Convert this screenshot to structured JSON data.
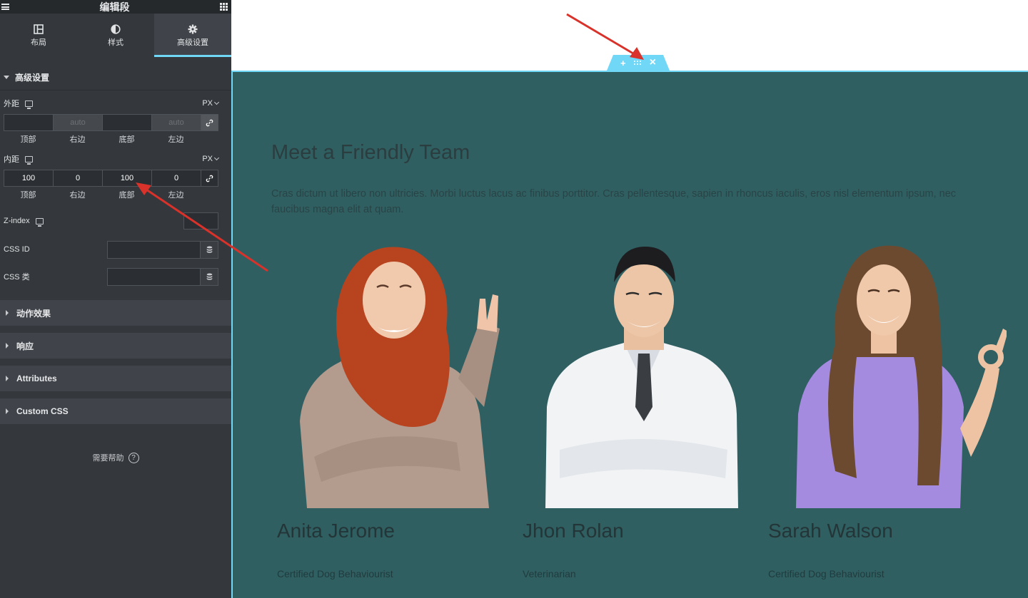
{
  "sidebar": {
    "title": "编辑段",
    "tabs": [
      {
        "label": "布局",
        "icon": "layout-icon"
      },
      {
        "label": "样式",
        "icon": "contrast-icon"
      },
      {
        "label": "高级设置",
        "icon": "gear-icon"
      }
    ],
    "active_tab": "高级设置",
    "advanced_section": {
      "title": "高级设置",
      "margin": {
        "label": "外距",
        "unit": "PX",
        "values": {
          "top": "",
          "right": "auto",
          "bottom": "",
          "left": "auto"
        },
        "sub_labels": [
          "顶部",
          "右边",
          "底部",
          "左边"
        ]
      },
      "padding": {
        "label": "内距",
        "unit": "PX",
        "values": {
          "top": "100",
          "right": "0",
          "bottom": "100",
          "left": "0"
        },
        "sub_labels": [
          "顶部",
          "右边",
          "底部",
          "左边"
        ]
      },
      "zindex_label": "Z-index",
      "css_id_label": "CSS ID",
      "css_class_label": "CSS 类"
    },
    "collapsed_sections": [
      "动作效果",
      "响应",
      "Attributes",
      "Custom CSS"
    ],
    "help_label": "需要帮助",
    "help_icon": "?"
  },
  "preview": {
    "handle_buttons": {
      "add": "+",
      "close": "×"
    },
    "heading": "Meet a Friendly Team",
    "paragraph": "Cras dictum ut libero non ultricies. Morbi luctus lacus ac finibus porttitor. Cras pellentesque, sapien in rhoncus iaculis, eros nisl elementum ipsum, nec faucibus magna elit at quam.",
    "team": [
      {
        "name": "Anita Jerome",
        "role": "Certified Dog Behaviourist"
      },
      {
        "name": "Jhon Rolan",
        "role": "Veterinarian"
      },
      {
        "name": "Sarah Walson",
        "role": "Certified Dog Behaviourist"
      }
    ],
    "colors": {
      "section_bg": "#305f62",
      "accent": "#71d7f7",
      "annotation_arrow": "#d8322a"
    }
  }
}
